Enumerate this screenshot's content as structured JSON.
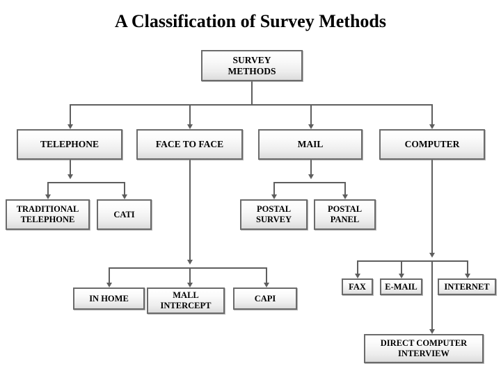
{
  "title": "A Classification of Survey Methods",
  "nodes": {
    "survey_methods": "SURVEY\nMETHODS",
    "survey_methods_l1": "SURVEY",
    "survey_methods_l2": "METHODS",
    "telephone": "TELEPHONE",
    "face_to_face": "FACE TO FACE",
    "mail": "MAIL",
    "computer": "COMPUTER",
    "traditional_telephone_l1": "TRADITIONAL",
    "traditional_telephone_l2": "TELEPHONE",
    "cati": "CATI",
    "postal_survey_l1": "POSTAL",
    "postal_survey_l2": "SURVEY",
    "postal_panel_l1": "POSTAL",
    "postal_panel_l2": "PANEL",
    "in_home": "IN HOME",
    "mall_intercept_l1": "MALL",
    "mall_intercept_l2": "INTERCEPT",
    "capi": "CAPI",
    "fax": "FAX",
    "email": "E-MAIL",
    "internet": "INTERNET",
    "direct_computer_interview_l1": "DIRECT COMPUTER",
    "direct_computer_interview_l2": "INTERVIEW"
  },
  "colors": {
    "border": "#6b6b6b",
    "connector": "#5e5e5e",
    "fill_top": "#ffffff",
    "fill_bottom": "#dcdcdc",
    "text": "#000000",
    "background": "#ffffff"
  },
  "chart_data": {
    "type": "diagram",
    "subtype": "hierarchy-tree",
    "title": "A Classification of Survey Methods",
    "root": "SURVEY METHODS",
    "levels": 4,
    "nodes": [
      {
        "id": "survey_methods",
        "label": "SURVEY METHODS",
        "level": 0,
        "parent": null
      },
      {
        "id": "telephone",
        "label": "TELEPHONE",
        "level": 1,
        "parent": "survey_methods"
      },
      {
        "id": "face_to_face",
        "label": "FACE TO FACE",
        "level": 1,
        "parent": "survey_methods"
      },
      {
        "id": "mail",
        "label": "MAIL",
        "level": 1,
        "parent": "survey_methods"
      },
      {
        "id": "computer",
        "label": "COMPUTER",
        "level": 1,
        "parent": "survey_methods"
      },
      {
        "id": "traditional_telephone",
        "label": "TRADITIONAL TELEPHONE",
        "level": 2,
        "parent": "telephone"
      },
      {
        "id": "cati",
        "label": "CATI",
        "level": 2,
        "parent": "telephone"
      },
      {
        "id": "postal_survey",
        "label": "POSTAL SURVEY",
        "level": 2,
        "parent": "mail"
      },
      {
        "id": "postal_panel",
        "label": "POSTAL PANEL",
        "level": 2,
        "parent": "mail"
      },
      {
        "id": "in_home",
        "label": "IN HOME",
        "level": 3,
        "parent": "face_to_face"
      },
      {
        "id": "mall_intercept",
        "label": "MALL INTERCEPT",
        "level": 3,
        "parent": "face_to_face"
      },
      {
        "id": "capi",
        "label": "CAPI",
        "level": 3,
        "parent": "face_to_face"
      },
      {
        "id": "fax",
        "label": "FAX",
        "level": 3,
        "parent": "computer"
      },
      {
        "id": "email",
        "label": "E-MAIL",
        "level": 3,
        "parent": "computer"
      },
      {
        "id": "internet",
        "label": "INTERNET",
        "level": 3,
        "parent": "computer"
      },
      {
        "id": "direct_computer_interview",
        "label": "DIRECT COMPUTER INTERVIEW",
        "level": 4,
        "parent": "computer"
      }
    ],
    "edges": [
      [
        "survey_methods",
        "telephone"
      ],
      [
        "survey_methods",
        "face_to_face"
      ],
      [
        "survey_methods",
        "mail"
      ],
      [
        "survey_methods",
        "computer"
      ],
      [
        "telephone",
        "traditional_telephone"
      ],
      [
        "telephone",
        "cati"
      ],
      [
        "mail",
        "postal_survey"
      ],
      [
        "mail",
        "postal_panel"
      ],
      [
        "face_to_face",
        "in_home"
      ],
      [
        "face_to_face",
        "mall_intercept"
      ],
      [
        "face_to_face",
        "capi"
      ],
      [
        "computer",
        "fax"
      ],
      [
        "computer",
        "email"
      ],
      [
        "computer",
        "internet"
      ],
      [
        "computer",
        "direct_computer_interview"
      ]
    ]
  }
}
